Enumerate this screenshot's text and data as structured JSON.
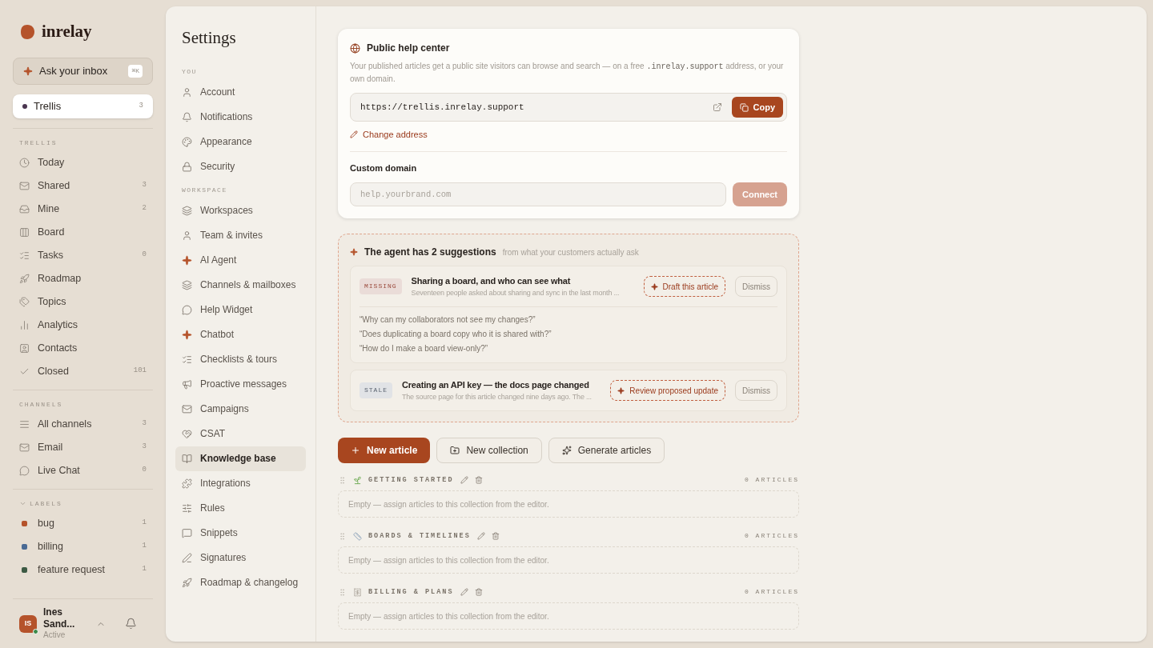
{
  "brand": {
    "name": "inrelay"
  },
  "ask": {
    "label": "Ask your inbox",
    "shortcut": "⌘K"
  },
  "workspace": {
    "name": "Trellis",
    "count": "3",
    "selected": true,
    "color": "#4a3550"
  },
  "sidebar": {
    "sections": [
      {
        "title": "TRELLIS",
        "items": [
          {
            "label": "Today"
          },
          {
            "label": "Shared",
            "count": "3"
          },
          {
            "label": "Mine",
            "count": "2"
          },
          {
            "label": "Board"
          },
          {
            "label": "Tasks",
            "count": "0"
          },
          {
            "label": "Roadmap"
          },
          {
            "label": "Topics"
          },
          {
            "label": "Analytics"
          },
          {
            "label": "Contacts"
          },
          {
            "label": "Closed",
            "count": "101"
          }
        ]
      },
      {
        "title": "CHANNELS",
        "items": [
          {
            "label": "All channels",
            "count": "3"
          },
          {
            "label": "Email",
            "count": "3"
          },
          {
            "label": "Live Chat",
            "count": "0"
          }
        ]
      },
      {
        "title": "LABELS",
        "expanded": true,
        "items": [
          {
            "label": "bug",
            "count": "1",
            "color": "#b5532b"
          },
          {
            "label": "billing",
            "count": "1",
            "color": "#4a6a94"
          },
          {
            "label": "feature request",
            "count": "1",
            "color": "#3c5a44"
          }
        ]
      }
    ]
  },
  "user": {
    "initials": "IS",
    "name": "Ines Sand...",
    "status": "Active",
    "online": true
  },
  "settings": {
    "title": "Settings",
    "groups": [
      {
        "title": "YOU",
        "items": [
          {
            "label": "Account",
            "selected": false
          },
          {
            "label": "Notifications",
            "selected": false
          },
          {
            "label": "Appearance",
            "selected": false
          },
          {
            "label": "Security",
            "selected": false
          }
        ]
      },
      {
        "title": "WORKSPACE",
        "items": [
          {
            "label": "Workspaces",
            "selected": false
          },
          {
            "label": "Team & invites",
            "selected": false
          },
          {
            "label": "AI Agent",
            "selected": false
          },
          {
            "label": "Channels & mailboxes",
            "selected": false
          },
          {
            "label": "Help Widget",
            "selected": false
          },
          {
            "label": "Chatbot",
            "selected": false
          },
          {
            "label": "Checklists & tours",
            "selected": false
          },
          {
            "label": "Proactive messages",
            "selected": false
          },
          {
            "label": "Campaigns",
            "selected": false
          },
          {
            "label": "CSAT",
            "selected": false
          },
          {
            "label": "Knowledge base",
            "selected": true
          },
          {
            "label": "Integrations",
            "selected": false
          },
          {
            "label": "Rules",
            "selected": false
          },
          {
            "label": "Snippets",
            "selected": false
          },
          {
            "label": "Signatures",
            "selected": false
          },
          {
            "label": "Roadmap & changelog",
            "selected": false
          }
        ]
      }
    ]
  },
  "help_center": {
    "title": "Public help center",
    "description_before": "Your published articles get a public site visitors can browse and search — on a free",
    "description_code": ".inrelay.support",
    "description_after": "address, or your own domain.",
    "url": "https://trellis.inrelay.support",
    "copy": "Copy",
    "change": "Change address",
    "custom_domain_label": "Custom domain",
    "custom_domain_placeholder": "help.yourbrand.com",
    "connect": "Connect",
    "connect_disabled": true
  },
  "suggestions": {
    "title": "The agent has 2 suggestions",
    "subtitle": "from what your customers actually ask",
    "items": [
      {
        "kind": "missing",
        "tag": "MISSING",
        "title": "Sharing a board, and who can see what",
        "detail": "Seventeen people asked about sharing and sync in the last month ...",
        "action": "Draft this article",
        "dismiss": "Dismiss",
        "questions": [
          "“Why can my collaborators not see my changes?”",
          "“Does duplicating a board copy who it is shared with?”",
          "“How do I make a board view-only?”"
        ]
      },
      {
        "kind": "stale",
        "tag": "STALE",
        "title": "Creating an API key — the docs page changed",
        "detail": "The source page for this article changed nine days ago. The ...",
        "action": "Review proposed update",
        "dismiss": "Dismiss"
      }
    ]
  },
  "actions": [
    {
      "kind": "primary",
      "label": "New article"
    },
    {
      "kind": "secondary",
      "label": "New collection"
    },
    {
      "kind": "secondary",
      "label": "Generate articles"
    }
  ],
  "collections": [
    {
      "name": "GETTING STARTED",
      "count": "0 ARTICLES",
      "empty": "Empty — assign articles to this collection from the editor."
    },
    {
      "name": "BOARDS & TIMELINES",
      "count": "0 ARTICLES",
      "empty": "Empty — assign articles to this collection from the editor."
    },
    {
      "name": "BILLING & PLANS",
      "count": "0 ARTICLES",
      "empty": "Empty — assign articles to this collection from the editor."
    }
  ]
}
